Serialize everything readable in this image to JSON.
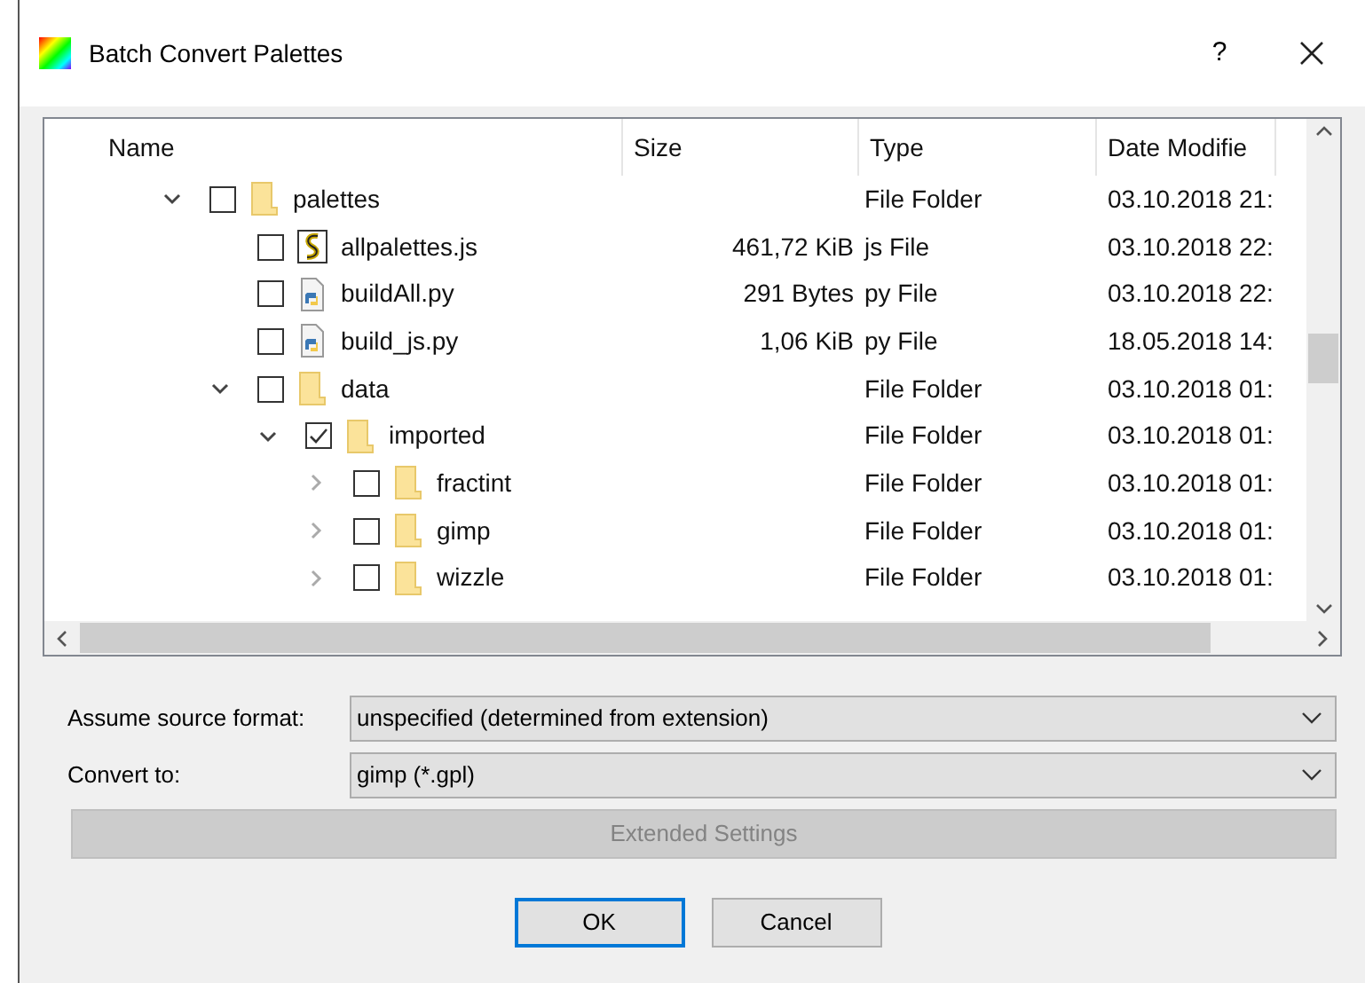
{
  "window": {
    "title": "Batch Convert Palettes",
    "help": "?"
  },
  "table": {
    "columns": [
      "Name",
      "Size",
      "Type",
      "Date Modifie"
    ],
    "tree": [
      {
        "name": "palettes",
        "kind": "folder",
        "expanded": true,
        "checked": false,
        "type": "File Folder",
        "date": "03.10.2018 21:",
        "children": [
          {
            "name": "allpalettes.js",
            "kind": "script",
            "checked": false,
            "size": "461,72 KiB",
            "type": "js File",
            "date": "03.10.2018 22:"
          },
          {
            "name": "buildAll.py",
            "kind": "python",
            "checked": false,
            "size": "291 Bytes",
            "type": "py File",
            "date": "03.10.2018 22:"
          },
          {
            "name": "build_js.py",
            "kind": "python",
            "checked": false,
            "size": "1,06 KiB",
            "type": "py File",
            "date": "18.05.2018 14:"
          },
          {
            "name": "data",
            "kind": "folder",
            "expanded": true,
            "checked": false,
            "type": "File Folder",
            "date": "03.10.2018 01:",
            "children": [
              {
                "name": "imported",
                "kind": "folder",
                "expanded": true,
                "checked": true,
                "type": "File Folder",
                "date": "03.10.2018 01:",
                "children": [
                  {
                    "name": "fractint",
                    "kind": "folder",
                    "expanded": false,
                    "checked": false,
                    "type": "File Folder",
                    "date": "03.10.2018 01:"
                  },
                  {
                    "name": "gimp",
                    "kind": "folder",
                    "expanded": false,
                    "checked": false,
                    "type": "File Folder",
                    "date": "03.10.2018 01:"
                  },
                  {
                    "name": "wizzle",
                    "kind": "folder",
                    "expanded": false,
                    "checked": false,
                    "type": "File Folder",
                    "date": "03.10.2018 01:"
                  }
                ]
              }
            ]
          }
        ]
      }
    ]
  },
  "form": [
    {
      "label": "Assume source format:",
      "value": "unspecified (determined from extension)"
    },
    {
      "label": "Convert to:",
      "value": "gimp (*.gpl)"
    }
  ],
  "extended_settings": {
    "label": "Extended Settings",
    "disabled": true
  },
  "buttons": [
    {
      "label": "OK",
      "selected": true
    },
    {
      "label": "Cancel",
      "selected": false
    }
  ]
}
